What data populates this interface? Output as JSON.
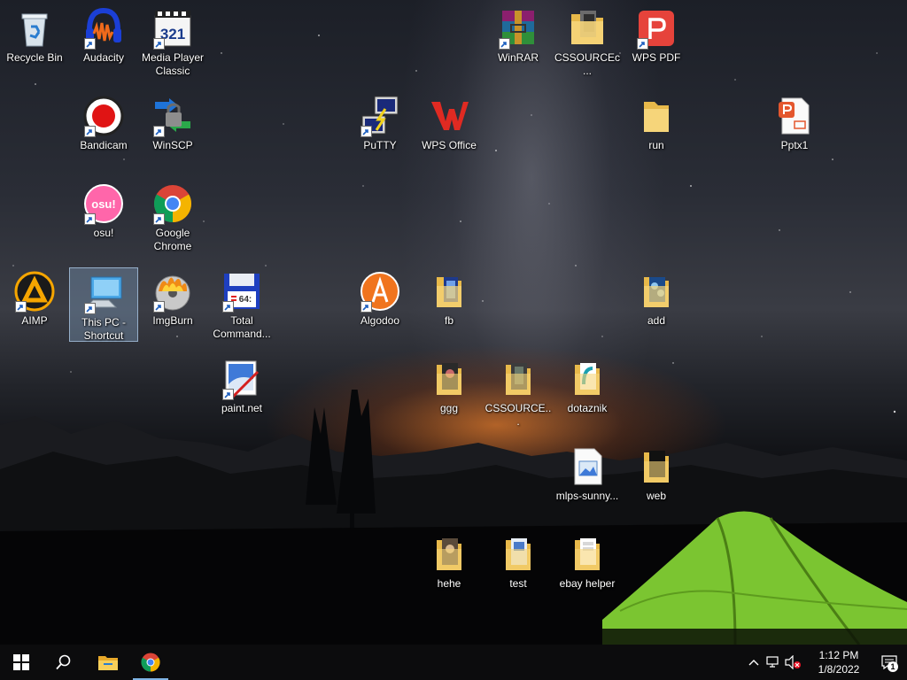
{
  "desktop": {
    "icons": {
      "recycle_bin": "Recycle Bin",
      "audacity": "Audacity",
      "media_player_classic": "Media Player Classic",
      "winrar": "WinRAR",
      "cssource_1": "CSSOURCEc...",
      "wps_pdf": "WPS PDF",
      "bandicam": "Bandicam",
      "winscp": "WinSCP",
      "putty": "PuTTY",
      "wps_office": "WPS Office",
      "run": "run",
      "pptx1": "Pptx1",
      "osu": "osu!",
      "google_chrome": "Google Chrome",
      "aimp": "AIMP",
      "this_pc": "This PC - Shortcut",
      "imgburn": "ImgBurn",
      "total_commander": "Total Command...",
      "algodoo": "Algodoo",
      "fb": "fb",
      "add": "add",
      "paint_net": "paint.net",
      "ggg": "ggg",
      "cssource_2": "CSSOURCE...",
      "dotaznik": "dotaznik",
      "mlps": "mlps-sunny...",
      "web": "web",
      "hehe": "hehe",
      "test": "test",
      "ebay_helper": "ebay helper"
    },
    "selected_icon": "This PC - Shortcut",
    "osu_logo_text": "osu!",
    "mpc_logo_text": "321",
    "tc_logo_text": "64:"
  },
  "taskbar": {
    "start_icon": "windows-logo-icon",
    "search_icon": "search-icon",
    "pinned": [
      "file-explorer-icon",
      "chrome-icon"
    ],
    "tray": {
      "icons": [
        "chevron-up-icon",
        "network-icon",
        "volume-muted-icon"
      ],
      "time": "1:12 PM",
      "date": "1/8/2022",
      "notifications_count": "1"
    }
  },
  "colors": {
    "taskbar_bg": "#0c0c0d",
    "selection": "#96bee6",
    "active_indicator": "#7fb4e4",
    "folder": "#f2c85a",
    "tent": "#8fd93a"
  }
}
